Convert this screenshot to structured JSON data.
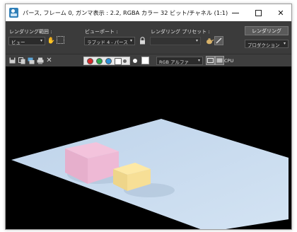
{
  "window": {
    "title": "パース, フレーム 0, ガンマ表示 : 2.2, RGBA カラー 32 ビット/チャネル (1:1)",
    "minimize_glyph": "",
    "maximize_glyph": "",
    "close_glyph": "✕"
  },
  "toolbar": {
    "render_area_label": "レンダリング範囲 :",
    "render_area_value": "ビュー",
    "viewport_label": "ビューポート :",
    "viewport_value": "ラプッド 4 - パース",
    "preset_label": "レンダリング プリセット :",
    "preset_value": "",
    "render_button": "レンダリング",
    "production_value": "プロダクション"
  },
  "toolbar2": {
    "channel_value": "RGB アルファ",
    "cpu_label": "CPU"
  },
  "colors": {
    "red_swatch": "#d42a2a",
    "green_swatch": "#2aa84a",
    "blue_swatch": "#2a90d8",
    "plane": "#c7dbef",
    "pink_box_top": "#f3c3dc",
    "yellow_box_top": "#fde9a6"
  },
  "icons": {
    "app": "3dsmax-app-icon",
    "teapot": "teapot-icon",
    "lock": "lock-icon",
    "save": "save-icon",
    "copy": "copy-icon",
    "clone": "clone-icon",
    "print": "print-icon",
    "clear": "clear-icon"
  }
}
